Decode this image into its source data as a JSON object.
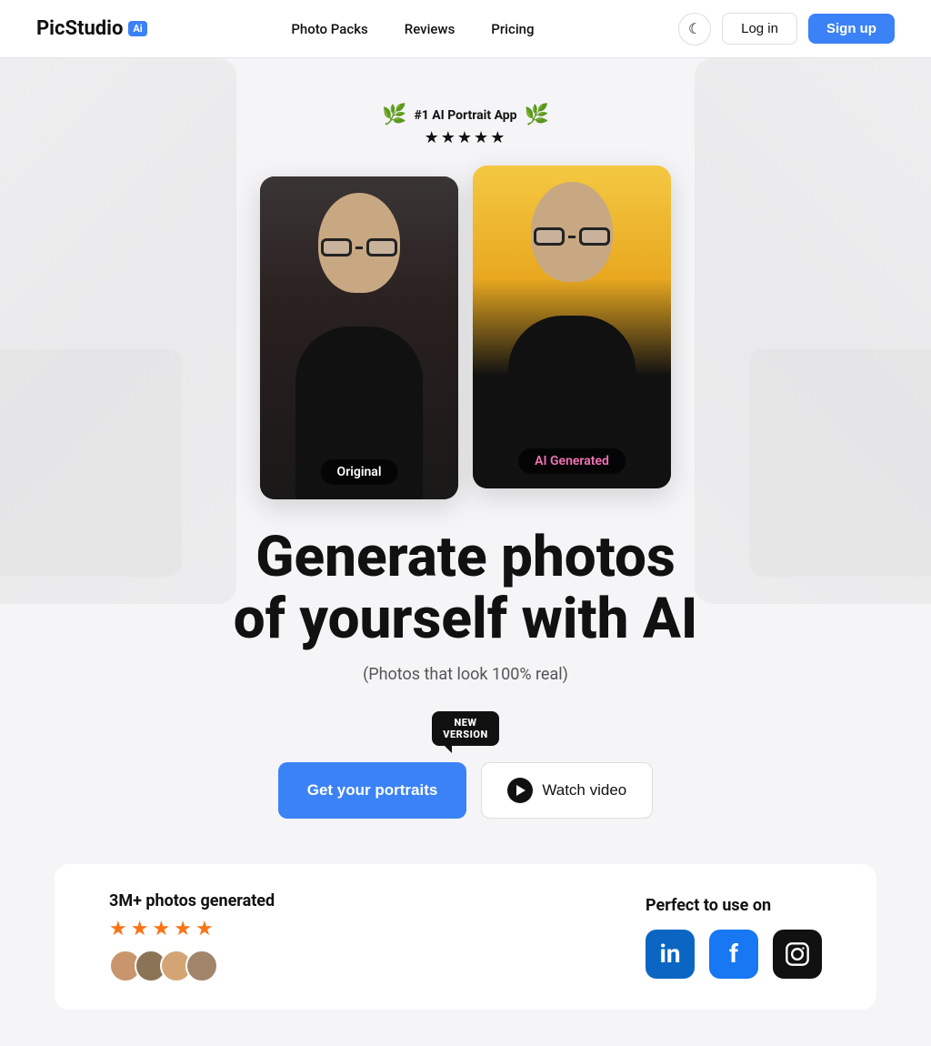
{
  "navbar": {
    "logo_text": "PicStudio",
    "logo_ai_label": "Ai",
    "links": [
      {
        "label": "Photo Packs",
        "href": "#"
      },
      {
        "label": "Reviews",
        "href": "#"
      },
      {
        "label": "Pricing",
        "href": "#"
      }
    ],
    "login_label": "Log in",
    "signup_label": "Sign up",
    "theme_icon": "☾"
  },
  "hero": {
    "award_text": "#1 AI Portrait App",
    "stars": "★★★★★",
    "card_original_label": "Original",
    "card_ai_label": "AI Generated",
    "title_line1": "Generate photos",
    "title_line2": "of yourself with AI",
    "subtitle": "(Photos that look 100% real)",
    "new_version_line1": "NEW",
    "new_version_line2": "VERSION",
    "cta_get_portraits": "Get your portraits",
    "cta_watch_video": "Watch video"
  },
  "social_proof": {
    "photos_count": "3M+ photos generated",
    "stars": [
      "★",
      "★",
      "★",
      "★",
      "★"
    ],
    "perfect_label": "Perfect to use on",
    "social_platforms": [
      {
        "name": "LinkedIn",
        "icon": "in"
      },
      {
        "name": "Facebook",
        "icon": "f"
      },
      {
        "name": "Instagram",
        "icon": "📷"
      }
    ]
  }
}
